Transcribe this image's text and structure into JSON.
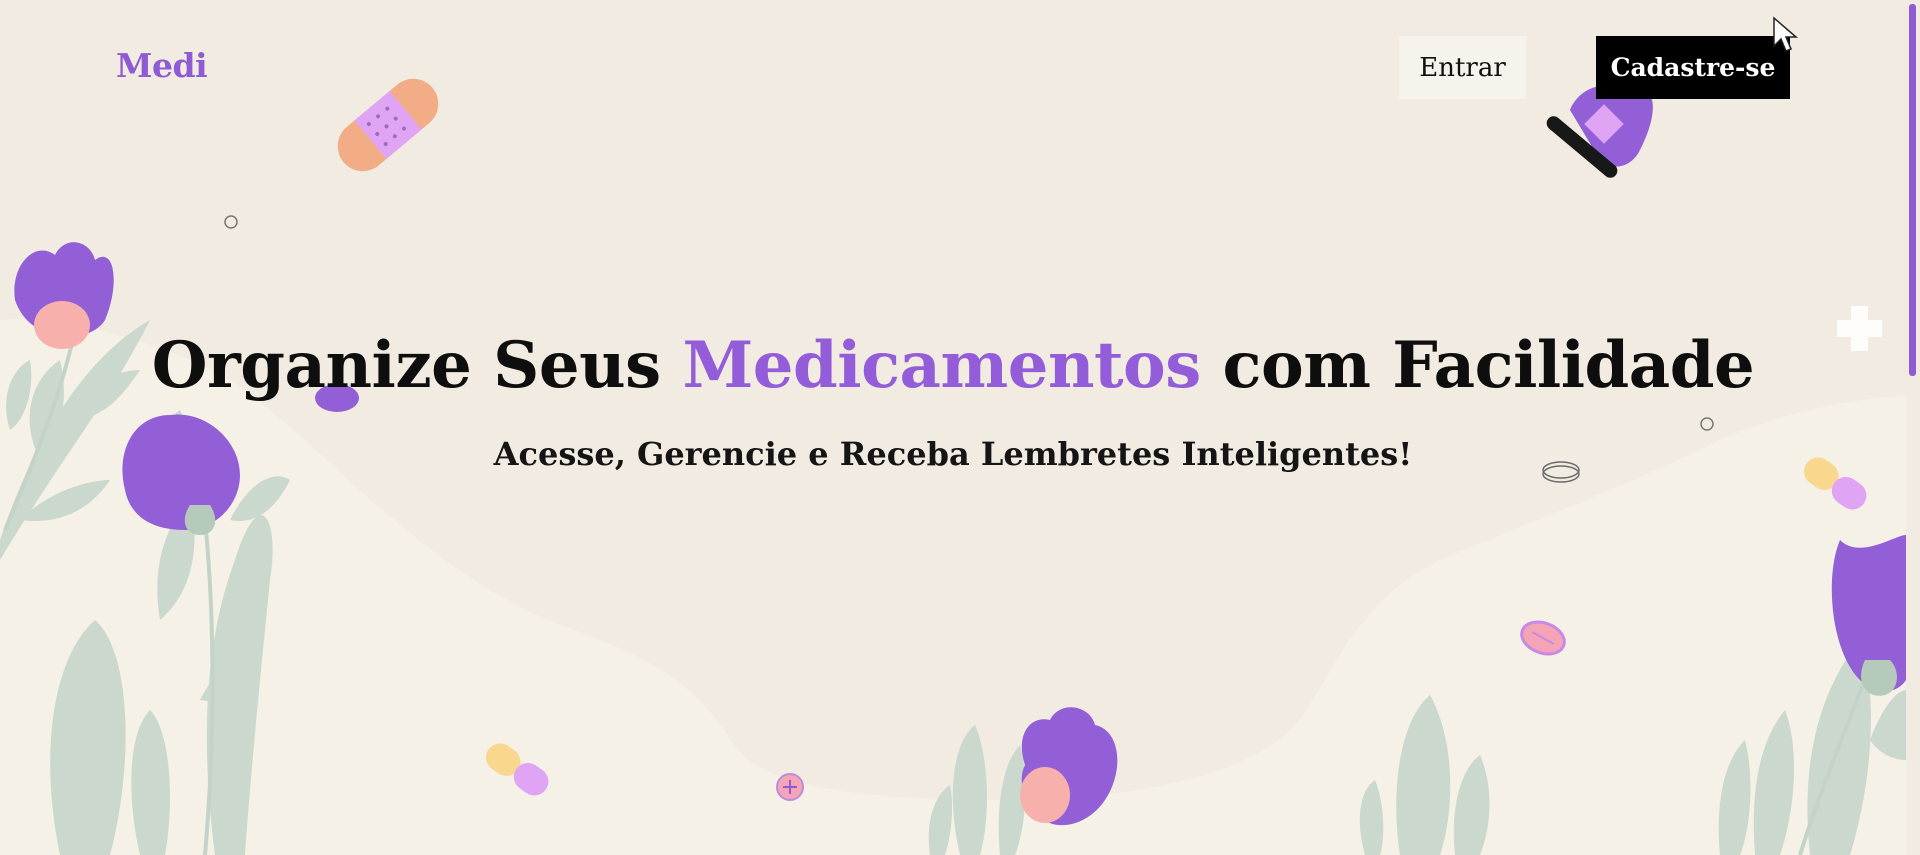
{
  "header": {
    "logo": "Medi",
    "login_label": "Entrar",
    "signup_label": "Cadastre-se"
  },
  "hero": {
    "headline_before": "Organize Seus ",
    "headline_accent": "Medicamentos",
    "headline_after": " com Facilidade",
    "subheadline": "Acesse, Gerencie e Receba Lembretes Inteligentes!"
  },
  "colors": {
    "background": "#f1ebe1",
    "accent": "#935cd8",
    "leaf": "#cad8cd",
    "flower_center": "#f8b0ad",
    "button_dark": "#000000"
  },
  "icons": [
    "bandage-icon",
    "pill-icon",
    "capsule-icon",
    "glove-icon",
    "flower-icon",
    "cross-icon"
  ]
}
